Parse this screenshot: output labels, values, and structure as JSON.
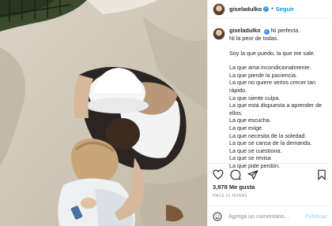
{
  "header": {
    "username": "giseladulko",
    "separator": "•",
    "follow_label": "Seguir"
  },
  "caption": {
    "username": "giseladulko",
    "first_line": "Ni perfecta.",
    "second_line": "Ni la peor de todas.",
    "intro": "Soy la que puedo, la que me sale.",
    "lines": [
      "La que ama incondicionalmente.",
      "La que pierde la paciencia.",
      "La que no quiere verlos crecer tan",
      "rápido.",
      "La que siente culpa.",
      "La que está dispuesta a aprender de",
      "ellos.",
      "La que escucha.",
      "La que exige.",
      "La que necesita de la soledad.",
      "La que se cansa de la demanda.",
      "La que se cuestiona.",
      "La que se revisa",
      "La que pide perdón."
    ]
  },
  "icons": {
    "like": "heart-icon",
    "comment": "comment-icon",
    "share": "share-icon",
    "save": "bookmark-icon",
    "emoji": "emoji-icon"
  },
  "likes": "3,978 Me gusta",
  "time": "HACE 21 HORAS",
  "comment_box": {
    "placeholder": "Agrega un comentario...",
    "publish_label": "Publicar"
  },
  "colors": {
    "link": "#0095f6",
    "verified": "#3897f0",
    "publish_disabled": "#b2dffc"
  }
}
